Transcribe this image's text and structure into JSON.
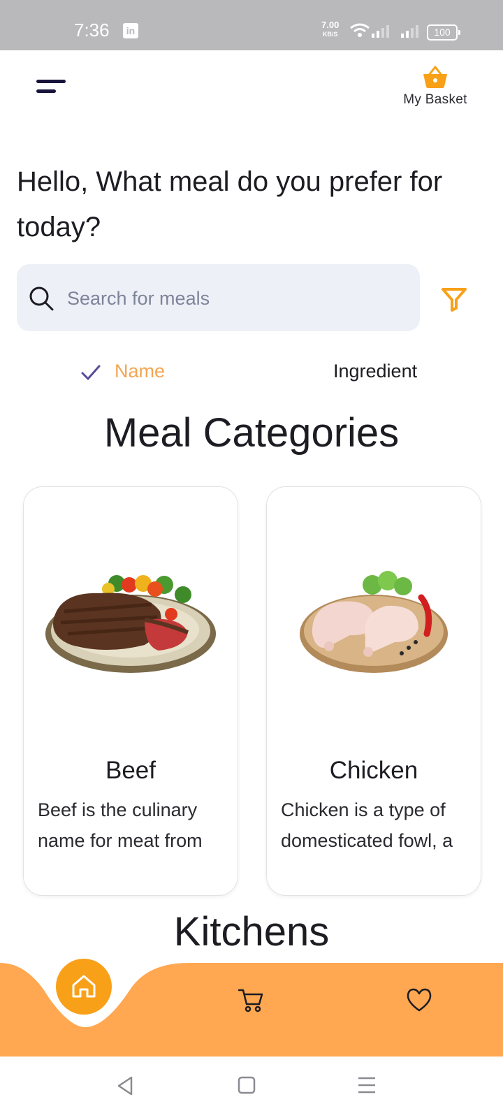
{
  "status_bar": {
    "time": "7:36",
    "notification_icon": "linkedin-icon",
    "net_speed": "7.00",
    "net_speed_unit": "KB/S",
    "battery": "100"
  },
  "header": {
    "menu_icon": "menu-icon",
    "basket_label": "My Basket",
    "basket_icon": "basket-icon"
  },
  "greeting": "Hello, What meal do you prefer for today?",
  "search": {
    "placeholder": "Search for meals",
    "value": "",
    "filter_icon": "filter-icon"
  },
  "search_modes": {
    "selected": "Name",
    "options": [
      "Name",
      "Ingredient"
    ]
  },
  "categories_title": "Meal Categories",
  "categories": [
    {
      "name": "Beef",
      "description_lines": [
        "Beef is the culinary",
        "name for meat from"
      ],
      "image": "grilled-steak-plate"
    },
    {
      "name": "Chicken",
      "description_lines": [
        "Chicken is a type of",
        "domesticated fowl, a"
      ],
      "image": "raw-chicken-legs-board"
    }
  ],
  "kitchens_title": "Kitchens",
  "bottom_nav": {
    "items": [
      "home",
      "cart",
      "favorites"
    ],
    "active": "home"
  },
  "colors": {
    "accent": "#f9a019",
    "nav_background": "#ffa751",
    "selected_text": "#f3a653",
    "check_mark": "#5a4a9a",
    "search_background": "#eef0f7",
    "menu_icon": "#17133a"
  }
}
